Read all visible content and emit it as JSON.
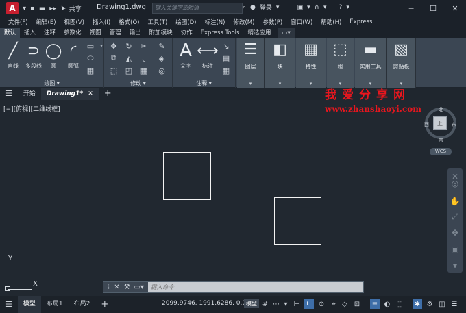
{
  "titlebar": {
    "logo_letter": "A",
    "share_label": "共享",
    "document_name": "Drawing1.dwg",
    "search_placeholder": "键入关键字或短语",
    "login_label": "登录"
  },
  "menu": [
    "文件(F)",
    "编辑(E)",
    "视图(V)",
    "插入(I)",
    "格式(O)",
    "工具(T)",
    "绘图(D)",
    "标注(N)",
    "修改(M)",
    "参数(P)",
    "窗口(W)",
    "帮助(H)",
    "Express"
  ],
  "ribbon_tabs": [
    {
      "label": "默认",
      "active": true
    },
    {
      "label": "插入",
      "active": false
    },
    {
      "label": "注释",
      "active": false
    },
    {
      "label": "参数化",
      "active": false
    },
    {
      "label": "视图",
      "active": false
    },
    {
      "label": "管理",
      "active": false
    },
    {
      "label": "输出",
      "active": false
    },
    {
      "label": "附加模块",
      "active": false
    },
    {
      "label": "协作",
      "active": false
    },
    {
      "label": "Express Tools",
      "active": false
    },
    {
      "label": "精选应用",
      "active": false
    }
  ],
  "ribbon": {
    "draw_panel": {
      "title": "绘图",
      "tools": [
        "直线",
        "多段线",
        "圆",
        "圆弧"
      ]
    },
    "modify_panel": {
      "title": "修改"
    },
    "annotation_panel": {
      "title": "注释",
      "tools": [
        "文字",
        "标注"
      ]
    },
    "blocks": [
      "图层",
      "块",
      "特性",
      "组",
      "实用工具",
      "剪贴板"
    ]
  },
  "doc_tabs": {
    "start_label": "开始",
    "active_label": "Drawing1*"
  },
  "viewport": {
    "label": "[−][俯视][二维线框]",
    "watermark_title": "我爱分享网",
    "watermark_url": "www.zhanshaoyi.com",
    "compass": {
      "north": "北",
      "south": "南",
      "west": "西",
      "east": "东"
    },
    "cube_face": "上",
    "wcs_label": "WCS",
    "ucs_y": "Y",
    "ucs_x": "X"
  },
  "command_line": {
    "placeholder": "键入命令"
  },
  "statusbar": {
    "layout_tabs": [
      {
        "label": "模型",
        "active": true
      },
      {
        "label": "布局1",
        "active": false
      },
      {
        "label": "布局2",
        "active": false
      }
    ],
    "coordinates": "2099.9746, 1991.6286, 0.0000",
    "model_label": "模型"
  }
}
